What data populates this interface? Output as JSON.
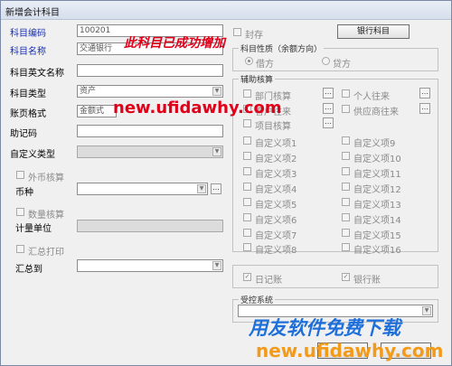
{
  "window": {
    "title": "新增会计科目"
  },
  "form": {
    "code_label": "科目编码",
    "code_value": "100201",
    "name_label": "科目名称",
    "name_value": "交通银行",
    "english_label": "科目英文名称",
    "type_label": "科目类型",
    "type_value": "资产",
    "format_label": "账页格式",
    "format_value": "金额式",
    "mnemonic_label": "助记码",
    "custom_type_label": "自定义类型",
    "foreign_label": "外币核算",
    "currency_label": "币种",
    "qty_label": "数量核算",
    "unit_label": "计量单位",
    "summary_label": "汇总打印",
    "summary_to_label": "汇总到"
  },
  "right": {
    "sealed_label": "封存",
    "bank_account_button": "银行科目",
    "nature_title": "科目性质（余额方向）",
    "debit_label": "借方",
    "credit_label": "贷方",
    "aux_title": "辅助核算",
    "aux_items": [
      "部门核算",
      "个人往来",
      "客户往来",
      "供应商往来",
      "项目核算"
    ],
    "custom_items": [
      "自定义项1",
      "自定义项9",
      "自定义项2",
      "自定义项10",
      "自定义项3",
      "自定义项11",
      "自定义项4",
      "自定义项12",
      "自定义项5",
      "自定义项13",
      "自定义项6",
      "自定义项14",
      "自定义项7",
      "自定义项15",
      "自定义项8",
      "自定义项16"
    ],
    "daily_label": "日记账",
    "bank_journal_label": "银行账",
    "controlled_title": "受控系统"
  },
  "overlays": {
    "success_text": "此科目已成功增加",
    "site_text": "new.ufidawhy.com",
    "brand_text": "用友软件免费下载",
    "brand_site": "new.ufidawhy.com"
  },
  "colors": {
    "label_blue": "#1a2fb0",
    "overlay_red": "#e0001a",
    "watermark_blue": "#1e6fd9"
  }
}
